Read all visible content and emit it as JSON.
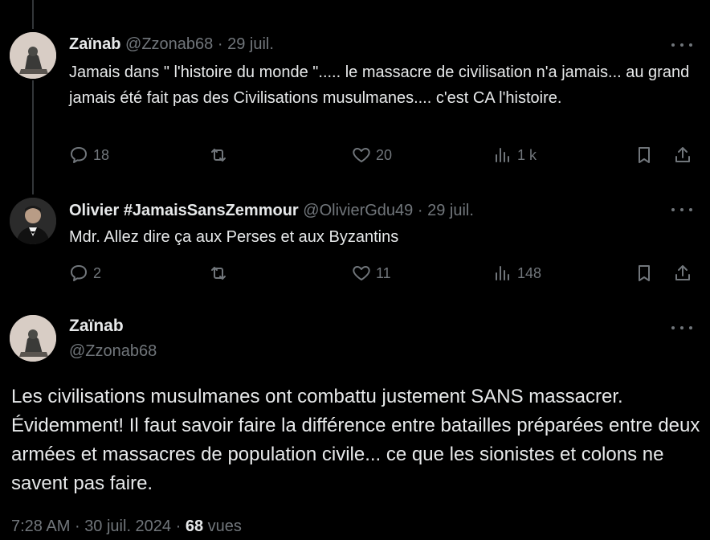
{
  "tweets": [
    {
      "name": "Zaïnab",
      "handle": "@Zzonab68",
      "date": "29 juil.",
      "text": "Jamais dans \" l'histoire du monde \"..... le massacre de civilisation n'a jamais... au grand jamais été fait pas des Civilisations musulmanes.... c'est CA l'histoire.",
      "replies": "18",
      "likes": "20",
      "views": "1 k"
    },
    {
      "name": "Olivier #JamaisSansZemmour",
      "handle": "@OlivierGdu49",
      "date": "29 juil.",
      "text": "Mdr. Allez dire ça aux Perses et aux Byzantins",
      "replies": "2",
      "likes": "11",
      "views": "148"
    }
  ],
  "main": {
    "name": "Zaïnab",
    "handle": "@Zzonab68",
    "text": "Les civilisations musulmanes ont combattu justement SANS massacrer. Évidemment!  Il faut savoir faire la différence entre batailles préparées entre deux armées et massacres de population civile... ce que les sionistes et colons ne savent pas faire.",
    "time": "7:28 AM",
    "date": "30 juil. 2024",
    "views_count": "68",
    "views_label": "vues"
  },
  "separator": "·",
  "colors": {
    "background": "#000000",
    "text": "#e7e9ea",
    "muted": "#71767b",
    "line": "#333639"
  },
  "icons": [
    "reply-icon",
    "retweet-icon",
    "like-icon",
    "views-icon",
    "bookmark-icon",
    "share-icon",
    "more-icon"
  ]
}
